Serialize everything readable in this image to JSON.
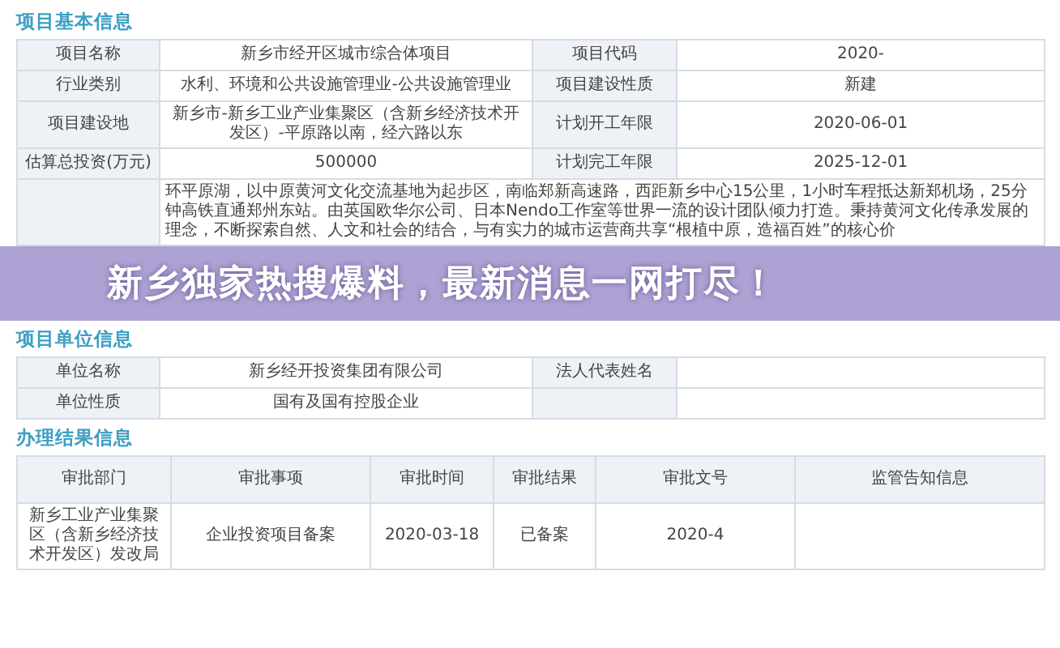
{
  "banner": {
    "text": "新乡独家热搜爆料，最新消息一网打尽！"
  },
  "basic": {
    "title": "项目基本信息",
    "rows": [
      {
        "label_1": "项目名称",
        "value_1": "新乡市经开区城市综合体项目",
        "label_2": "项目代码",
        "value_2": "2020-"
      },
      {
        "label_1": "行业类别",
        "value_1": "水利、环境和公共设施管理业-公共设施管理业",
        "label_2": "项目建设性质",
        "value_2": "新建"
      },
      {
        "label_1": "项目建设地",
        "value_1": "新乡市-新乡工业产业集聚区（含新乡经济技术开发区）-平原路以南，经六路以东",
        "label_2": "计划开工年限",
        "value_2": "2020-06-01"
      },
      {
        "label_1": "估算总投资(万元)",
        "value_1": "500000",
        "label_2": "计划完工年限",
        "value_2": "2025-12-01"
      }
    ],
    "description": {
      "text": "环平原湖，以中原黄河文化交流基地为起步区，南临郑新高速路，西距新乡中心15公里，1小时车程抵达新郑机场，25分钟高铁直通郑州东站。由英国欧华尔公司、日本Nendo工作室等世界一流的设计团队倾力打造。秉持黄河文化传承发展的理念，不断探索自然、人文和社会的结合，与有实力的城市运营商共享“根植中原，造福百姓”的核心价"
    }
  },
  "unit": {
    "title": "项目单位信息",
    "rows": [
      {
        "label_1": "单位名称",
        "value_1": "新乡经开投资集团有限公司",
        "label_2": "法人代表姓名"
      },
      {
        "label_1": "单位性质",
        "value_1": "国有及国有控股企业"
      }
    ]
  },
  "result": {
    "title": "办理结果信息",
    "columns": [
      "审批部门",
      "审批事项",
      "审批时间",
      "审批结果",
      "审批文号",
      "监管告知信息"
    ],
    "rows": [
      [
        "新乡工业产业集聚区（含新乡经济技术开发区）发改局",
        "企业投资项目备案",
        "2020-03-18",
        "已备案",
        "2020-4",
        ""
      ]
    ]
  }
}
